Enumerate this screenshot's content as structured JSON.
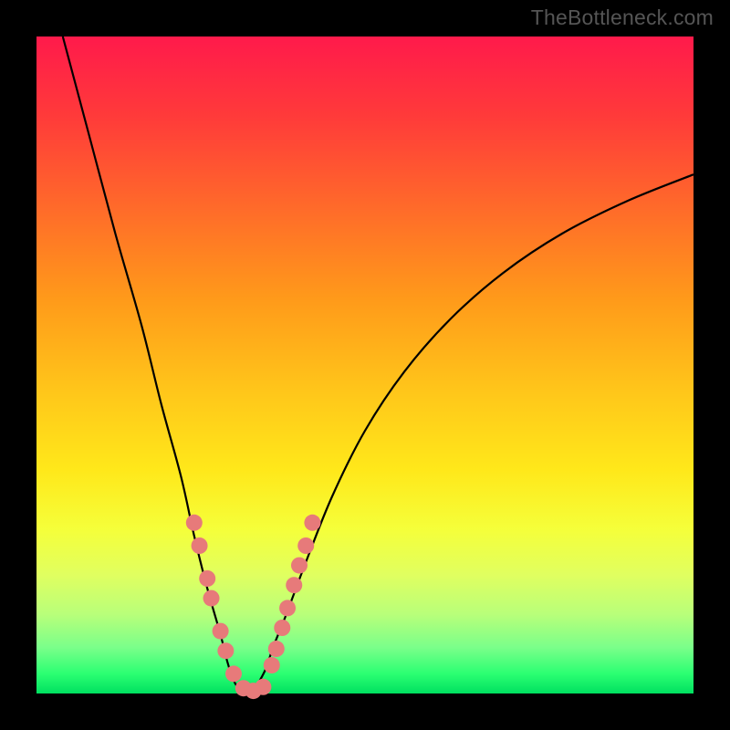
{
  "watermark": "TheBottleneck.com",
  "chart_data": {
    "type": "line",
    "title": "",
    "xlabel": "",
    "ylabel": "",
    "xlim": [
      0,
      100
    ],
    "ylim": [
      0,
      100
    ],
    "grid": false,
    "legend": false,
    "series": [
      {
        "name": "bottleneck-curve",
        "x": [
          4,
          8,
          12,
          16,
          19,
          22,
          24,
          26,
          28,
          29,
          30,
          31,
          32,
          33,
          34,
          35,
          36,
          38,
          41,
          45,
          50,
          56,
          63,
          71,
          80,
          90,
          100
        ],
        "y": [
          100,
          85,
          70,
          56,
          44,
          33,
          24,
          16,
          9,
          5,
          2,
          0.5,
          0,
          0.5,
          2,
          4,
          7,
          12,
          20,
          30,
          40,
          49,
          57,
          64,
          70,
          75,
          79
        ]
      }
    ],
    "markers": {
      "name": "highlight-dots",
      "color": "#e77a7a",
      "points_xy": [
        [
          24,
          26
        ],
        [
          24.8,
          22.5
        ],
        [
          26,
          17.5
        ],
        [
          26.6,
          14.5
        ],
        [
          28,
          9.5
        ],
        [
          28.8,
          6.5
        ],
        [
          30,
          3
        ],
        [
          31.5,
          0.8
        ],
        [
          33,
          0.4
        ],
        [
          34.5,
          1
        ],
        [
          35.8,
          4.3
        ],
        [
          36.5,
          6.8
        ],
        [
          37.4,
          10
        ],
        [
          38.2,
          13
        ],
        [
          39.2,
          16.5
        ],
        [
          40,
          19.5
        ],
        [
          41,
          22.5
        ],
        [
          42,
          26
        ]
      ]
    },
    "background_gradient": {
      "top": "#ff1a4b",
      "mid": "#ffe81a",
      "bottom": "#00e060"
    }
  }
}
